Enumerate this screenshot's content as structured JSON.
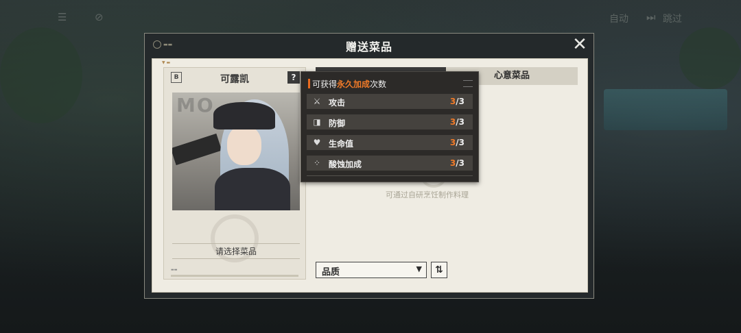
{
  "topbar": {
    "list_icon": "list-icon",
    "hide_icon": "eye-off-icon",
    "auto_label": "自动",
    "skip_icon": "skip-icon",
    "skip_label": "跳过"
  },
  "dialog": {
    "title": "赠送菜品",
    "close_icon": "close-icon",
    "logo_icon": "logo-mark-icon"
  },
  "character": {
    "name": "可露凯",
    "help_label": "?",
    "select_dish_label": "请选择菜品"
  },
  "tabs": [
    {
      "label": ""
    },
    {
      "label": "心意菜品"
    }
  ],
  "empty_hint": "可通过自研烹饪制作料理",
  "filter": {
    "quality_label": "品质",
    "caret_icon": "caret-down-icon",
    "sort_icon": "sort-icon",
    "sort_glyph": "⇅"
  },
  "tooltip": {
    "title_prefix": "可获得",
    "title_highlight": "永久加成",
    "title_suffix": "次数",
    "rows": [
      {
        "icon": "attack-icon",
        "glyph": "⚔",
        "label": "攻击",
        "current": "3",
        "max": "/3"
      },
      {
        "icon": "shield-icon",
        "glyph": "◨",
        "label": "防御",
        "current": "3",
        "max": "/3"
      },
      {
        "icon": "heart-icon",
        "glyph": "♥",
        "label": "生命值",
        "current": "3",
        "max": "/3"
      },
      {
        "icon": "corrosion-icon",
        "glyph": "⁘",
        "label": "酸蚀加成",
        "current": "3",
        "max": "/3"
      }
    ]
  },
  "colors": {
    "accent": "#f07a28",
    "paper": "#efece3",
    "dialog_bg": "#24292b"
  }
}
